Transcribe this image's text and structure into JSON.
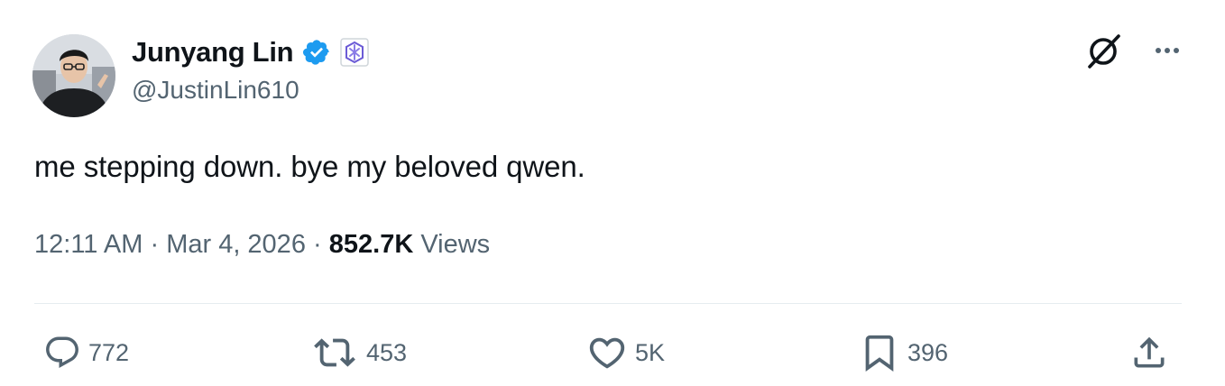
{
  "author": {
    "display_name": "Junyang Lin",
    "handle": "@JustinLin610",
    "verified_badge": "verified-checkmark-icon",
    "affiliate_badge": "qwen-affiliate-logo"
  },
  "tweet": {
    "text": "me stepping down. bye my beloved qwen.",
    "time": "12:11 AM",
    "date": "Mar 4, 2026",
    "views_count": "852.7K",
    "views_label": "Views",
    "separator": "·"
  },
  "top_actions": {
    "grok_icon": "grok-icon",
    "more_icon": "more-icon"
  },
  "actions": {
    "replies": "772",
    "reposts": "453",
    "likes": "5K",
    "bookmarks": "396"
  },
  "colors": {
    "text_primary": "#0f1419",
    "text_secondary": "#536471",
    "verified_blue": "#1d9bf0",
    "divider": "#e6ecf0"
  }
}
